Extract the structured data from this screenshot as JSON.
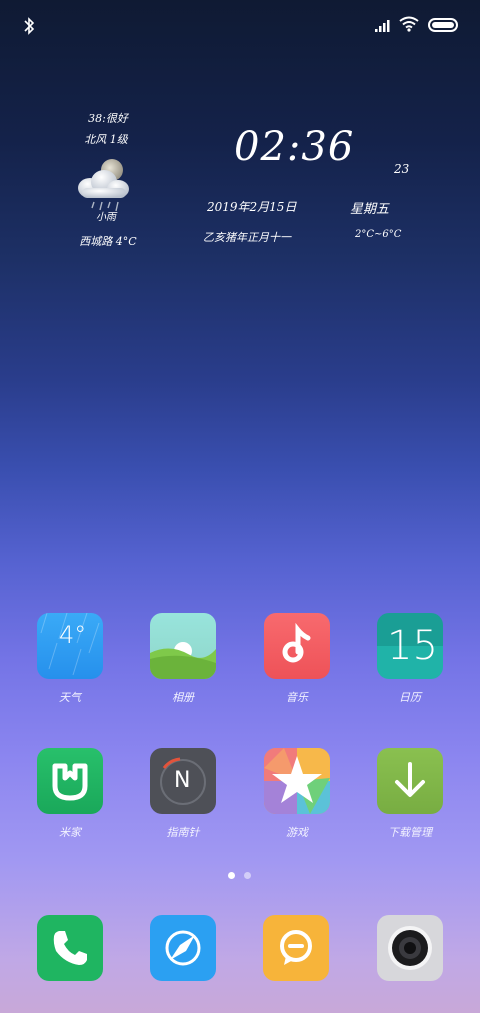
{
  "status_bar": {
    "icons": [
      "bluetooth-icon",
      "cellular-signal-icon",
      "wifi-icon",
      "battery-icon"
    ],
    "battery_level": 1.0
  },
  "weather_widget": {
    "aqi": "38:很好",
    "wind": "北风 1级",
    "condition": "小雨",
    "location_temp": "西城路 4°C",
    "icon": "cloud-moon-rain-icon"
  },
  "clock": {
    "time": "02:36",
    "seconds": "23",
    "date": "2019年2月15日",
    "weekday": "星期五",
    "lunar": "乙亥猪年正月十一",
    "temp_range": "2°C~6°C"
  },
  "apps": [
    {
      "label": "天气",
      "icon_text": "4°",
      "icon": "weather-app-icon",
      "color": "#2e9ff3"
    },
    {
      "label": "相册",
      "icon": "gallery-app-icon",
      "color": "#8fd6c9"
    },
    {
      "label": "音乐",
      "icon": "music-app-icon",
      "color": "#f25c63"
    },
    {
      "label": "日历",
      "icon_text": "15",
      "icon": "calendar-app-icon",
      "color": "#1aa79c"
    },
    {
      "label": "米家",
      "icon": "mijia-app-icon",
      "color": "#1fb561"
    },
    {
      "label": "指南针",
      "icon_text": "N",
      "icon": "compass-app-icon",
      "color": "#4e5057"
    },
    {
      "label": "游戏",
      "icon": "games-app-icon",
      "color": "#f1a43a"
    },
    {
      "label": "下载管理",
      "icon": "download-manager-app-icon",
      "color": "#80b64a"
    }
  ],
  "page_indicator": {
    "count": 2,
    "active": 1
  },
  "dock": [
    {
      "icon": "phone-app-icon",
      "color": "#1fb561"
    },
    {
      "icon": "browser-app-icon",
      "color": "#2ba0f2"
    },
    {
      "icon": "messages-app-icon",
      "color": "#f7b43a"
    },
    {
      "icon": "camera-app-icon",
      "color": "#d7d7db"
    }
  ]
}
